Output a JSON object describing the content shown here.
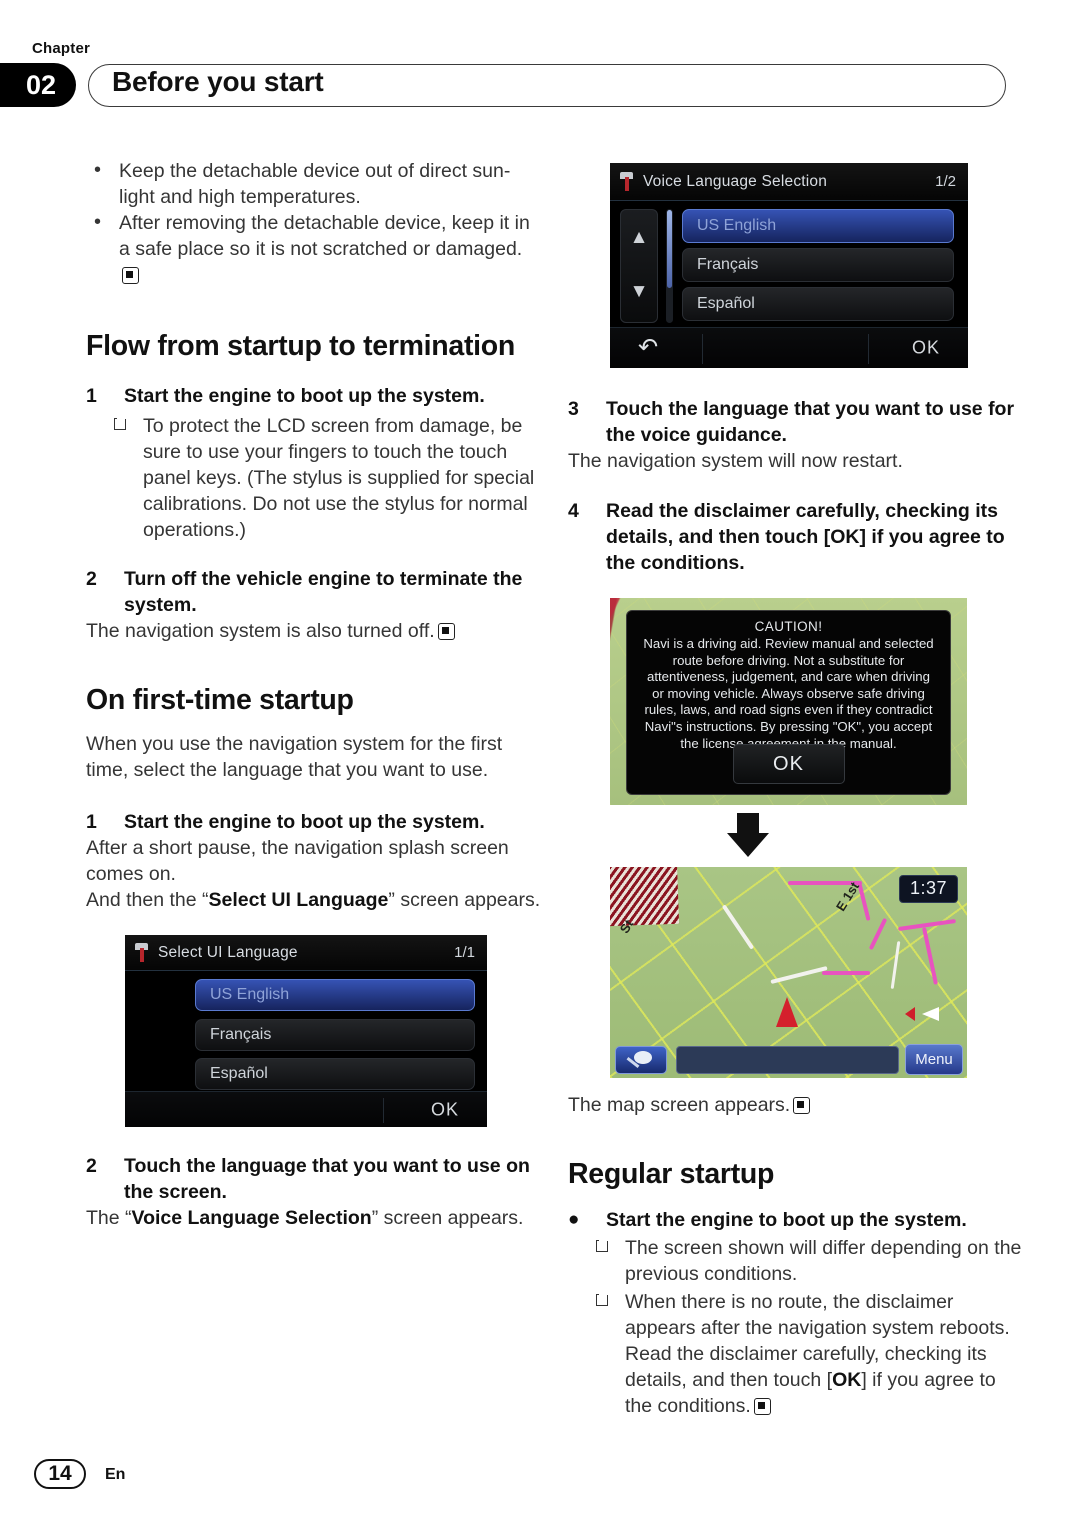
{
  "header": {
    "chapter_label": "Chapter",
    "chapter_number": "02",
    "title": "Before you start"
  },
  "footer": {
    "page_number": "14",
    "language_code": "En"
  },
  "left_column": {
    "bullets": [
      "Keep the detachable device out of direct sun-light and high temperatures.",
      "After removing the detachable device, keep it in a safe place so it is not scratched or damaged."
    ],
    "heading_flow": "Flow from startup to termination",
    "step1_num": "1",
    "step1_text": "Start the engine to boot up the system.",
    "note1": "To protect the LCD screen from damage, be sure to use your fingers to touch the touch panel keys. (The stylus is supplied for special calibrations. Do not use the stylus for normal operations.)",
    "step2_num": "2",
    "step2_text": "Turn off the vehicle engine to terminate the system.",
    "step2_result": "The navigation system is also turned off.",
    "heading_firsttime": "On first-time startup",
    "intro": "When you use the navigation system for the first time, select the language that you want to use.",
    "ft_step1_num": "1",
    "ft_step1_text": "Start the engine to boot up the system.",
    "ft_step1_result_a": "After a short pause, the navigation splash screen comes on.",
    "ft_step1_result_b_pre": "And then the “",
    "ft_step1_result_b_bold": "Select UI Language",
    "ft_step1_result_b_post": "” screen appears.",
    "ft_step2_num": "2",
    "ft_step2_text": "Touch the language that you want to use on the screen.",
    "ft_step2_result_pre": "The “",
    "ft_step2_result_bold": "Voice Language Selection",
    "ft_step2_result_post": "” screen appears."
  },
  "right_column": {
    "step3_num": "3",
    "step3_text": "Touch the language that you want to use for the voice guidance.",
    "step3_result": "The navigation system will now restart.",
    "step4_num": "4",
    "step4_text": "Read the disclaimer carefully, checking its details, and then touch [OK] if you agree to the conditions.",
    "map_caption": "The map screen appears.",
    "heading_regular": "Regular startup",
    "reg_bullet_text": "Start the engine to boot up the system.",
    "reg_note1": "The screen shown will differ depending on the previous conditions.",
    "reg_note2_a": "When there is no route, the disclaimer appears after the navigation system reboots. Read the disclaimer carefully, checking its details, and then touch [",
    "reg_note2_bold": "OK",
    "reg_note2_b": "] if you agree to the conditions."
  },
  "screenshots": {
    "select_ui_language": {
      "title": "Select UI Language",
      "page_indicator": "1/1",
      "items": [
        "US English",
        "Français",
        "Español"
      ],
      "selected_index": 0,
      "ok_label": "OK"
    },
    "voice_language_selection": {
      "title": "Voice Language Selection",
      "page_indicator": "1/2",
      "items": [
        "US English",
        "Français",
        "Español"
      ],
      "selected_index": 0,
      "ok_label": "OK",
      "scroll_up_icon": "double-chevron-up",
      "scroll_down_icon": "double-chevron-down",
      "back_icon": "back-arrow"
    },
    "caution_dialog": {
      "title": "CAUTION!",
      "body": "Navi is a driving aid. Review manual and selected route before driving. Not a substitute for attentiveness, judgement, and care when driving or moving vehicle. Always observe safe driving rules, laws, and road signs even if they contradict Navi\"s instructions. By pressing \"OK\", you accept the license agreement in the manual.",
      "ok_label": "OK"
    },
    "map_screen": {
      "clock": "1:37",
      "menu_label": "Menu",
      "street_label_1": "St",
      "street_label_2": "E 1st",
      "zoom_icon": "magnifier-map-icon"
    }
  },
  "colors": {
    "accent_black": "#000000",
    "map_green": "#9dbb76",
    "route_pink": "#e853c0",
    "selected_blue": "#3653b4",
    "button_blue": "#3f63c7"
  }
}
